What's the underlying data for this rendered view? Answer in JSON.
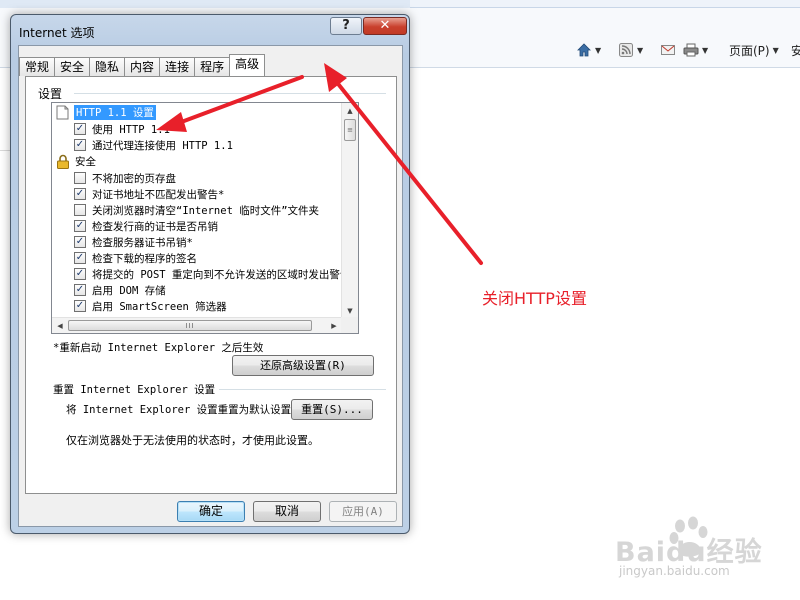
{
  "browser": {
    "toolbar": {
      "home_icon": "home-icon",
      "feeds_icon": "rss-icon",
      "mail_icon": "mail-icon",
      "print_icon": "print-icon",
      "page_label": "页面(P)",
      "safety_label": "安"
    }
  },
  "dialog": {
    "title": "Internet 选项",
    "help_label": "?",
    "close_label": "✕",
    "tabs": [
      {
        "label": "常规",
        "active": false
      },
      {
        "label": "安全",
        "active": false
      },
      {
        "label": "隐私",
        "active": false
      },
      {
        "label": "内容",
        "active": false
      },
      {
        "label": "连接",
        "active": false
      },
      {
        "label": "程序",
        "active": false
      },
      {
        "label": "高级",
        "active": true
      }
    ],
    "settings_label": "设置",
    "settings_items": [
      {
        "type": "category",
        "icon": "page-icon",
        "label": "HTTP 1.1 设置",
        "selected": true
      },
      {
        "type": "checkbox",
        "checked": true,
        "label": "使用 HTTP 1.1"
      },
      {
        "type": "checkbox",
        "checked": true,
        "label": "通过代理连接使用 HTTP 1.1"
      },
      {
        "type": "category",
        "icon": "lock-icon",
        "label": "安全",
        "selected": false
      },
      {
        "type": "checkbox",
        "checked": false,
        "label": "不将加密的页存盘"
      },
      {
        "type": "checkbox",
        "checked": true,
        "label": "对证书地址不匹配发出警告*"
      },
      {
        "type": "checkbox",
        "checked": false,
        "label": "关闭浏览器时清空“Internet 临时文件”文件夹"
      },
      {
        "type": "checkbox",
        "checked": true,
        "label": "检查发行商的证书是否吊销"
      },
      {
        "type": "checkbox",
        "checked": true,
        "label": "检查服务器证书吊销*"
      },
      {
        "type": "checkbox",
        "checked": true,
        "label": "检查下载的程序的签名"
      },
      {
        "type": "checkbox",
        "checked": true,
        "label": "将提交的 POST 重定向到不允许发送的区域时发出警告"
      },
      {
        "type": "checkbox",
        "checked": true,
        "label": "启用 DOM 存储"
      },
      {
        "type": "checkbox",
        "checked": true,
        "label": "启用 SmartScreen 筛选器"
      }
    ],
    "restart_note": "*重新启动 Internet Explorer 之后生效",
    "restore_button": "还原高级设置(R)",
    "reset_group_title": "重置 Internet Explorer 设置",
    "reset_desc": "将 Internet Explorer 设置重置为默认设置。",
    "reset_button": "重置(S)...",
    "reset_hint": "仅在浏览器处于无法使用的状态时，才使用此设置。",
    "ok_button": "确定",
    "cancel_button": "取消",
    "apply_button": "应用(A)"
  },
  "annotation": {
    "text": "关闭HTTP设置",
    "color": "#e8202a"
  },
  "watermark": {
    "brand": "Baidu经验",
    "url": "jingyan.baidu.com"
  }
}
